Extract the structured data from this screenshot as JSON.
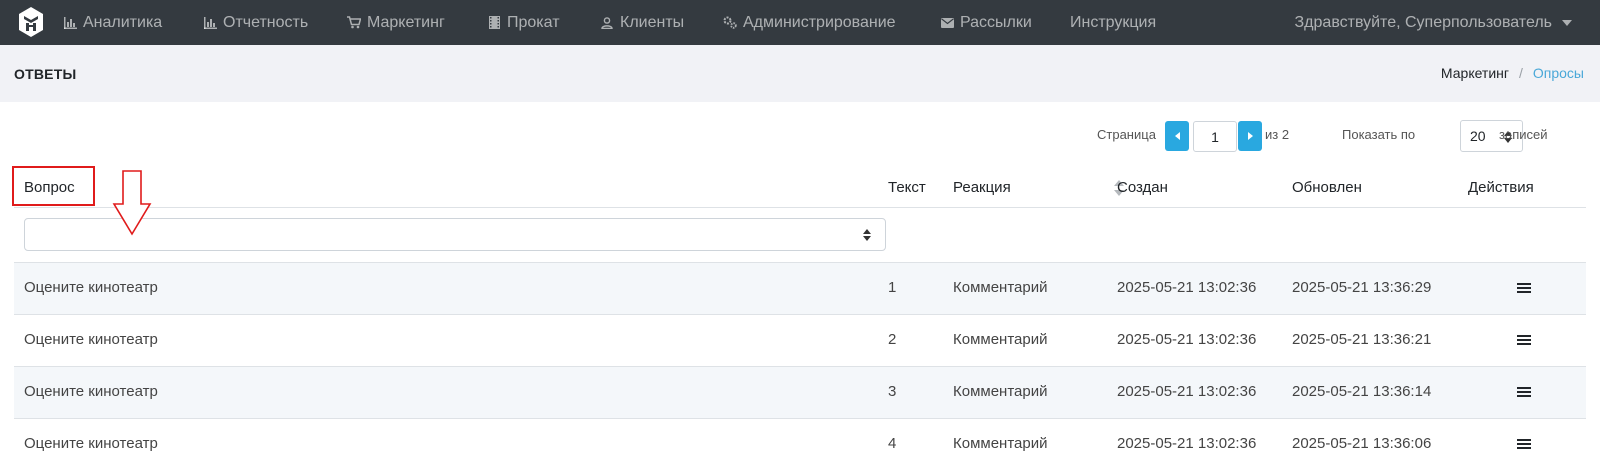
{
  "navbar": {
    "items": [
      {
        "label": "Аналитика",
        "icon": "bar-chart-icon"
      },
      {
        "label": "Отчетность",
        "icon": "bar-chart-icon"
      },
      {
        "label": "Маркетинг",
        "icon": "cart-icon"
      },
      {
        "label": "Прокат",
        "icon": "film-icon"
      },
      {
        "label": "Клиенты",
        "icon": "user-icon"
      },
      {
        "label": "Администрирование",
        "icon": "gears-icon"
      },
      {
        "label": "Рассылки",
        "icon": "envelope-icon"
      },
      {
        "label": "Инструкция",
        "icon": ""
      }
    ],
    "user_greeting": "Здравствуйте, Суперпользователь"
  },
  "header": {
    "title": "ОТВЕТЫ",
    "breadcrumb": [
      "Маркетинг",
      "Опросы"
    ],
    "breadcrumb_separator": "/"
  },
  "pagination": {
    "page_label": "Страница",
    "current_page": "1",
    "of_label": "из 2",
    "show_label": "Показать по",
    "per_page": "20",
    "records_label": "записей"
  },
  "table": {
    "columns": [
      "Вопрос",
      "Текст",
      "Реакция",
      "Создан",
      "Обновлен",
      "Действия"
    ],
    "rows": [
      {
        "question": "Оцените кинотеатр",
        "text": "1",
        "reaction": "Комментарий",
        "created": "2025-05-21 13:02:36",
        "updated": "2025-05-21 13:36:29"
      },
      {
        "question": "Оцените кинотеатр",
        "text": "2",
        "reaction": "Комментарий",
        "created": "2025-05-21 13:02:36",
        "updated": "2025-05-21 13:36:21"
      },
      {
        "question": "Оцените кинотеатр",
        "text": "3",
        "reaction": "Комментарий",
        "created": "2025-05-21 13:02:36",
        "updated": "2025-05-21 13:36:14"
      },
      {
        "question": "Оцените кинотеатр",
        "text": "4",
        "reaction": "Комментарий",
        "created": "2025-05-21 13:02:36",
        "updated": "2025-05-21 13:36:06"
      }
    ]
  },
  "colors": {
    "navbar_bg": "#343a40",
    "accent": "#29a8e0",
    "annotation": "#e01b1b"
  }
}
